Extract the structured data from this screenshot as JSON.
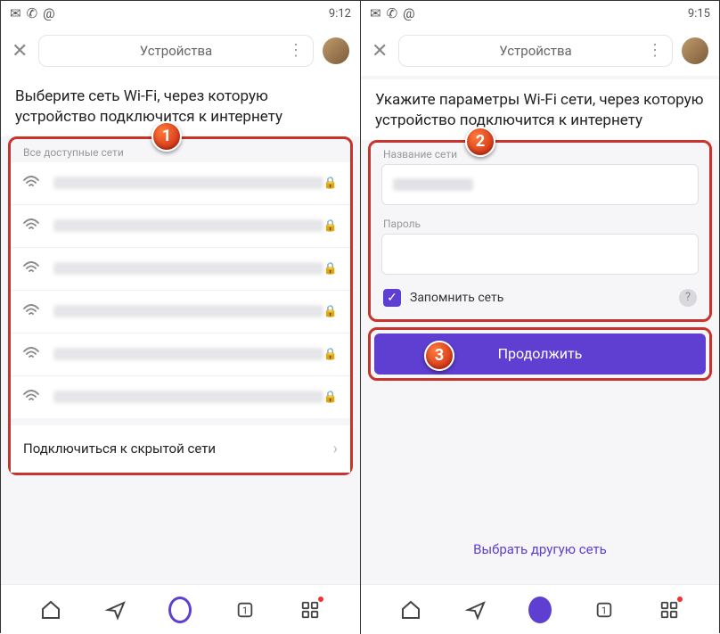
{
  "left": {
    "statusbar": {
      "time": "9:12"
    },
    "navbar": {
      "title": "Устройства"
    },
    "heading": "Выберите сеть Wi-Fi, через которую устройство подключится к интернету",
    "list_header": "Все доступные сети",
    "hidden_net": "Подключиться к скрытой сети",
    "badge": "1"
  },
  "right": {
    "statusbar": {
      "time": "9:15"
    },
    "navbar": {
      "title": "Устройства"
    },
    "heading": "Укажите параметры Wi-Fi сети, через которую устройство подключится к интернету",
    "name_label": "Название сети",
    "pass_label": "Пароль",
    "remember": "Запомнить сеть",
    "continue_btn": "Продолжить",
    "other_net": "Выбрать другую сеть",
    "badge2": "2",
    "badge3": "3"
  }
}
